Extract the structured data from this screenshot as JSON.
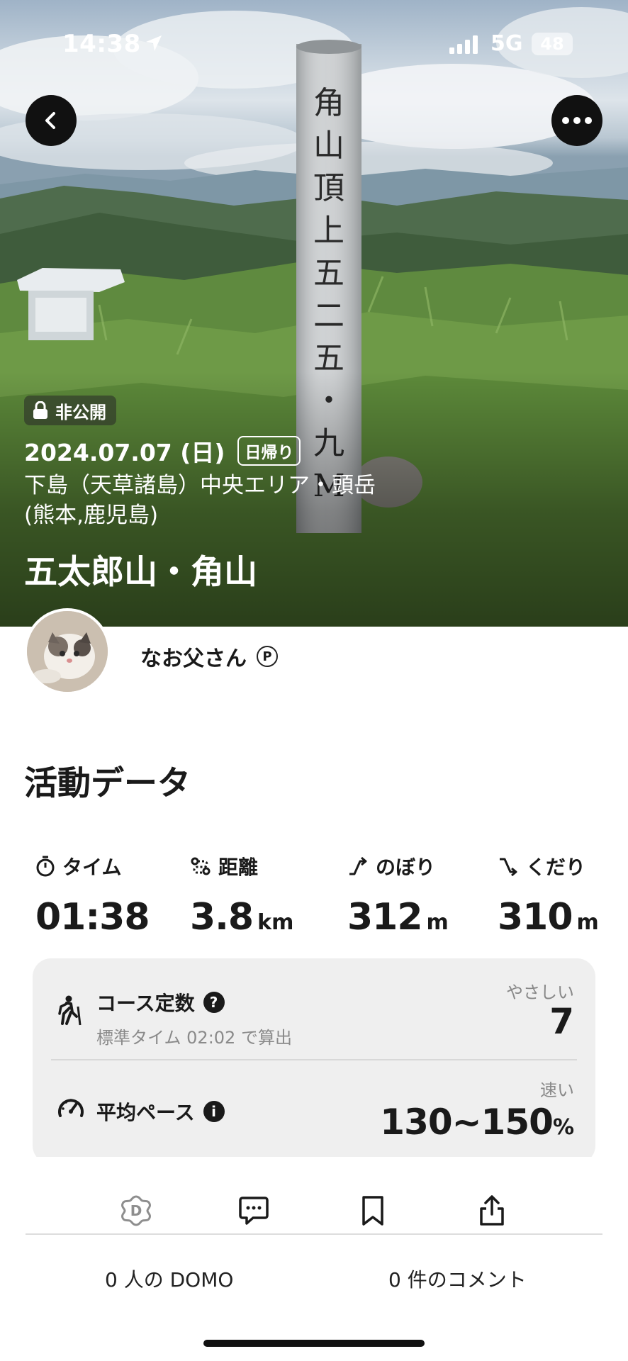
{
  "status_bar": {
    "time": "14:38",
    "network": "5G",
    "battery": "48"
  },
  "hero": {
    "privacy_label": "非公開",
    "date": "2024.07.07 (日)",
    "trip_type": "日帰り",
    "area_line1": "下島（天草諸島）中央エリア・頭岳",
    "area_line2": "(熊本,鹿児島)",
    "title": "五太郎山・角山",
    "signpost_text": "角山頂上五二五・九M"
  },
  "user": {
    "name": "なお父さん",
    "premium_mark": "P"
  },
  "activity": {
    "section_title": "活動データ",
    "stats": {
      "time": {
        "label": "タイム",
        "value": "01:38",
        "unit": ""
      },
      "distance": {
        "label": "距離",
        "value": "3.8",
        "unit": "km"
      },
      "ascent": {
        "label": "のぼり",
        "value": "312",
        "unit": "m"
      },
      "descent": {
        "label": "くだり",
        "value": "310",
        "unit": "m"
      }
    },
    "course_constant": {
      "title": "コース定数",
      "help_mark": "?",
      "subtitle": "標準タイム 02:02 で算出",
      "rating": "やさしい",
      "value": "7"
    },
    "average_pace": {
      "title": "平均ペース",
      "info_mark": "i",
      "rating": "速い",
      "value": "130~150",
      "unit": "%"
    }
  },
  "bottom_bar": {
    "icons": [
      "domo-icon",
      "comment-icon",
      "bookmark-icon",
      "share-icon"
    ],
    "domo_count": "0 人の DOMO",
    "comment_count": "0 件のコメント"
  },
  "colors": {
    "text": "#1a1a1a",
    "card_bg": "#efefef",
    "muted": "#8a8a8a"
  }
}
